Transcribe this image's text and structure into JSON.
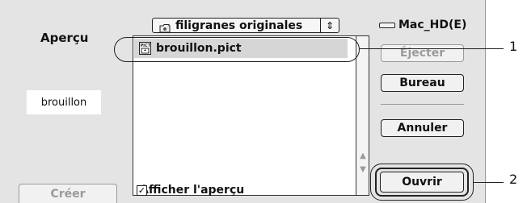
{
  "folder_popup": {
    "label": "filigranes originales",
    "icon": "folder-icon",
    "arrows": "⇕"
  },
  "volume": {
    "label": "Mac_HD(E)",
    "icon": "disk-icon"
  },
  "preview": {
    "title": "Aperçu",
    "file_name": "brouillon",
    "create_label": "Créer"
  },
  "files": [
    {
      "name": "brouillon.pict",
      "icon": "pict-file-icon",
      "selected": true
    }
  ],
  "buttons": {
    "eject": "Éjecter",
    "desktop": "Bureau",
    "cancel": "Annuler",
    "open": "Ouvrir"
  },
  "show_preview": {
    "label": "Afficher l'aperçu",
    "checked": true
  },
  "callouts": {
    "one": "1",
    "two": "2"
  }
}
